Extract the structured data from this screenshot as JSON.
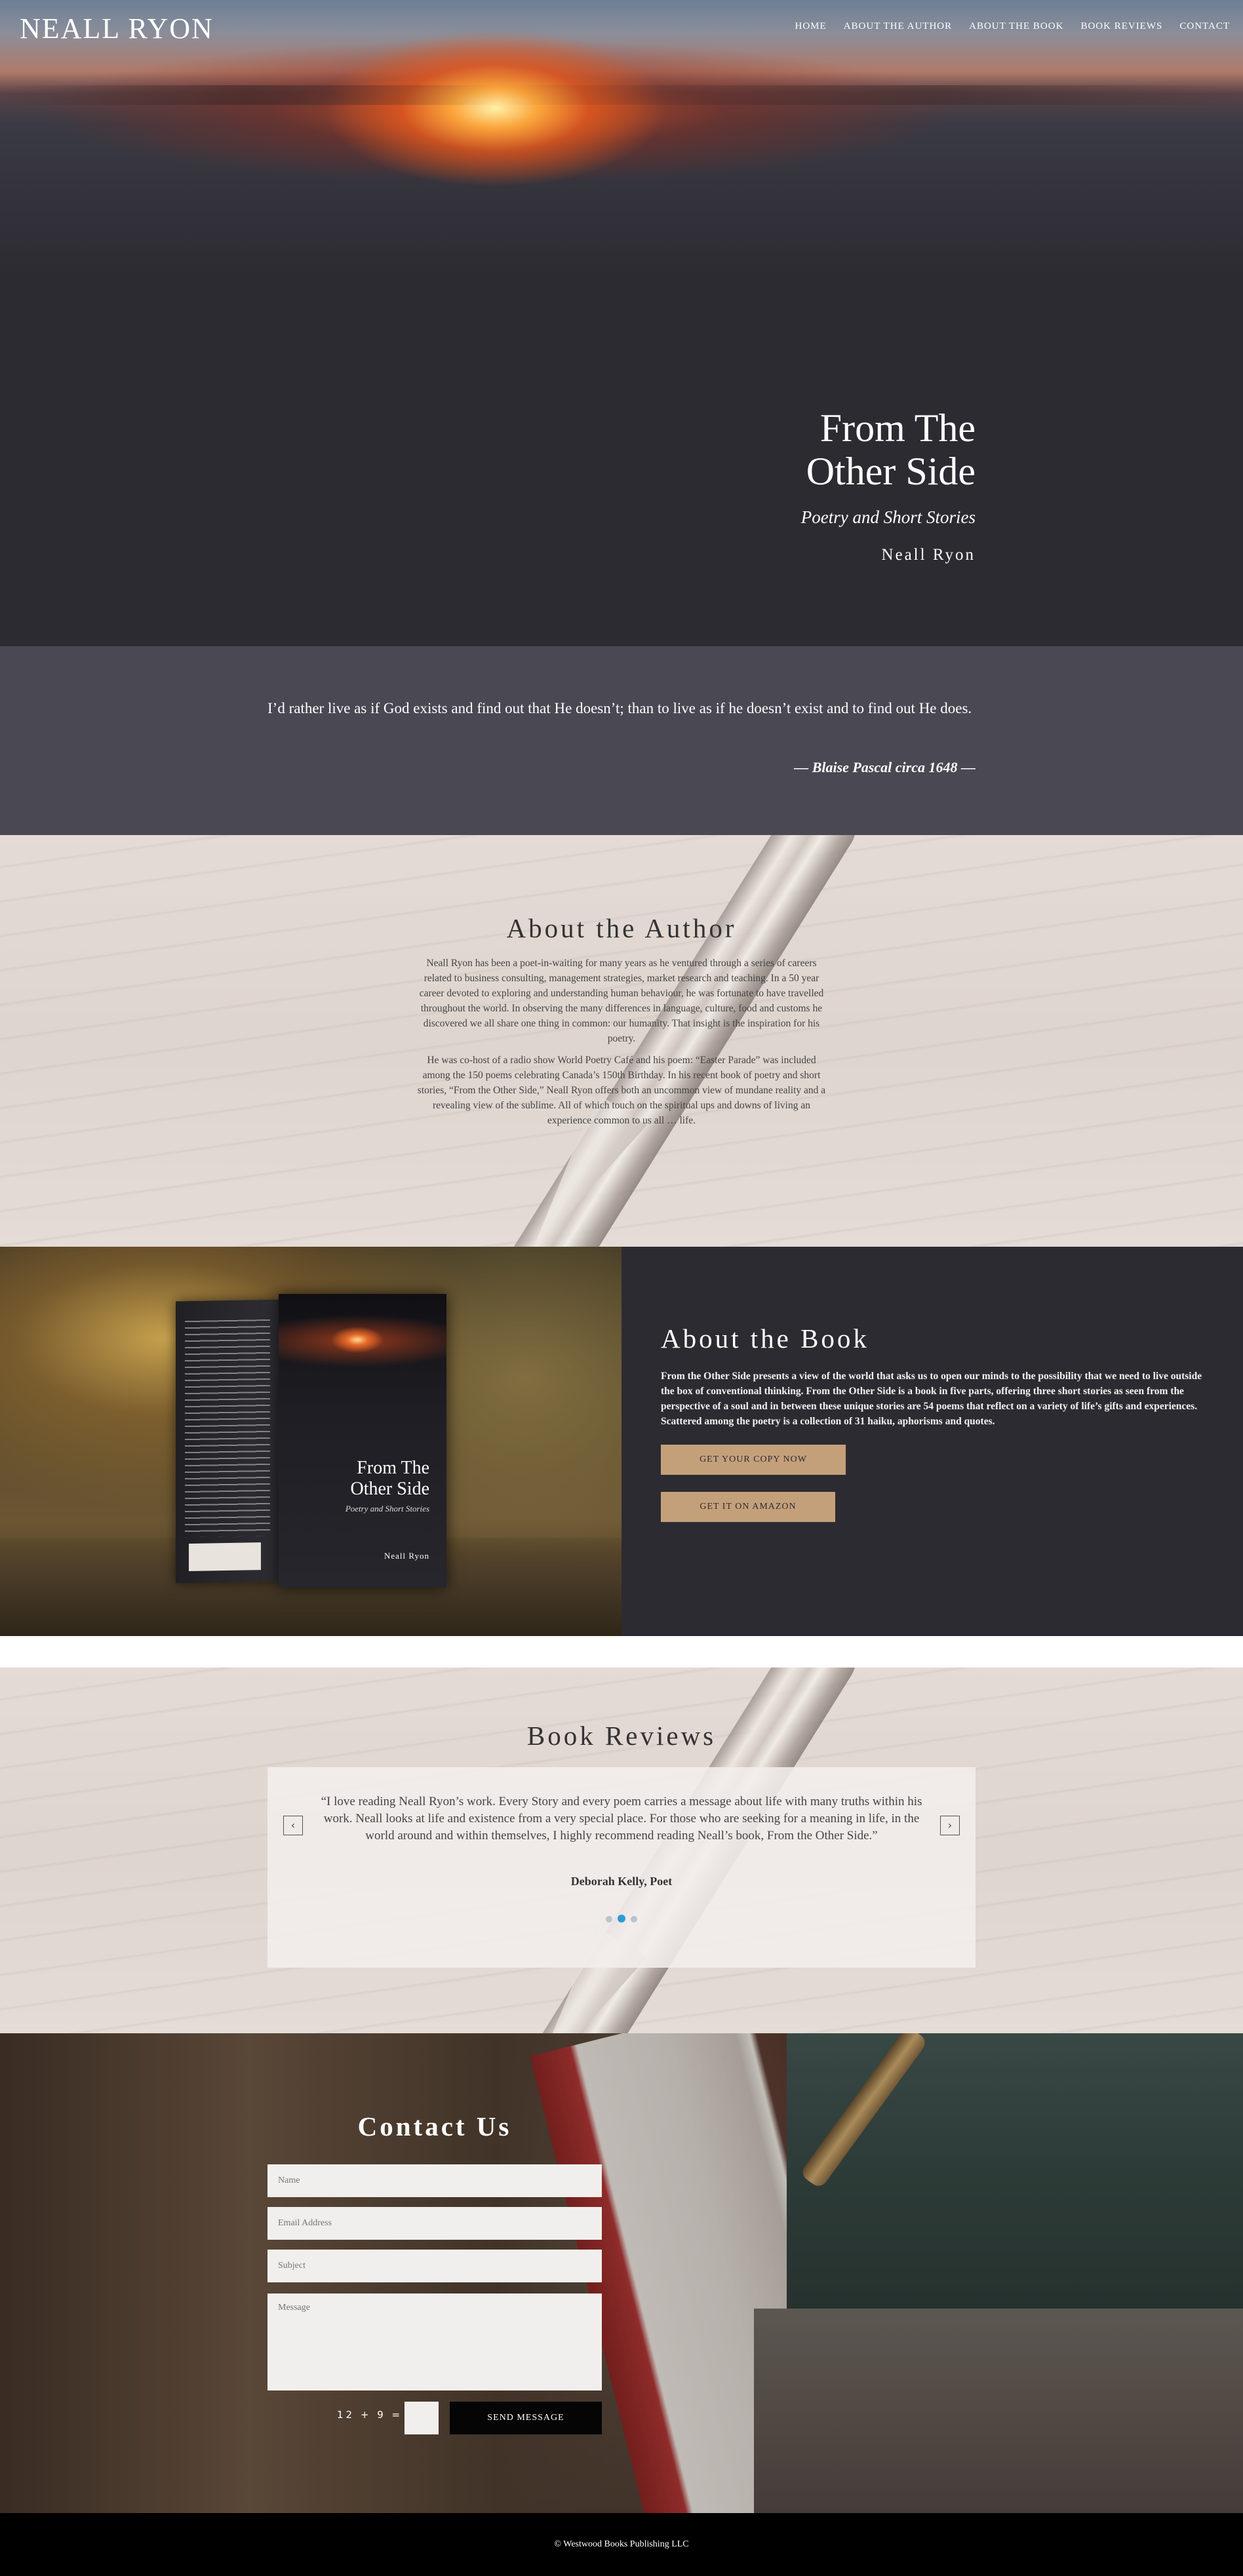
{
  "header": {
    "logo": "NEALL RYON",
    "nav": [
      "HOME",
      "ABOUT THE AUTHOR",
      "ABOUT THE BOOK",
      "BOOK REVIEWS",
      "CONTACT"
    ]
  },
  "hero": {
    "title_line1": "From The",
    "title_line2": "Other Side",
    "subtitle": "Poetry and Short Stories",
    "author": "Neall Ryon"
  },
  "quote": {
    "text": "I’d rather live as if God exists and find out that He doesn’t; than to live as if he doesn’t exist and to find out He does.",
    "source": "— Blaise Pascal circa 1648 —"
  },
  "author_section": {
    "title": "About the Author",
    "p1": "Neall Ryon has been a poet-in-waiting for many years as he ventured through a series of careers related to business consulting, management strategies, market research and teaching. In a 50 year career devoted to exploring and understanding human behaviour, he was fortunate to have travelled throughout the world. In observing the many differences in language, culture, food and customs he discovered we all share one thing in common: our humanity. That insight is the inspiration for his poetry.",
    "p2": "He was co-host of a radio show World Poetry Café and his poem: “Easter Parade” was included among the 150 poems celebrating Canada’s 150th Birthday. In his recent book of poetry and short stories, “From the Other Side,” Neall Ryon offers both an uncommon view of mundane reality and a revealing view of the sublime. All of which touch on the spiritual ups and downs of living an experience common to us all … life."
  },
  "book_section": {
    "cover_title_line1": "From The",
    "cover_title_line2": "Other Side",
    "cover_subtitle": "Poetry and Short Stories",
    "cover_author": "Neall Ryon",
    "title": "About the Book",
    "description": "From the Other Side presents a view of the world that asks us to open our minds to the possibility that we need to live outside the box of conventional thinking. From the Other Side is a book in five parts, offering three short stories as seen from the perspective of a soul and in between these unique stories are 54 poems that reflect on a variety of life’s gifts and experiences. Scattered among the poetry is a collection of 31 haiku, aphorisms and quotes.",
    "button1": "GET YOUR COPY NOW",
    "button2": "GET IT ON AMAZON"
  },
  "reviews": {
    "title": "Book Reviews",
    "prev": "‹",
    "next": "›",
    "text": "“I love reading Neall Ryon’s work. Every Story and every poem carries a message about life with many truths within his work. Neall looks at life and existence from a very special place. For those who are seeking for a meaning in life, in the world around and within themselves, I highly recommend reading Neall’s book, From the Other Side.”",
    "reviewer": "Deborah Kelly, Poet",
    "slide_count": 3,
    "active_slide": 2
  },
  "contact": {
    "title": "Contact Us",
    "name_placeholder": "Name",
    "email_placeholder": "Email Address",
    "subject_placeholder": "Subject",
    "message_placeholder": "Message",
    "captcha": "12 + 9 =",
    "send": "SEND MESSAGE"
  },
  "footer": {
    "text": "© Westwood Books Publishing LLC"
  }
}
